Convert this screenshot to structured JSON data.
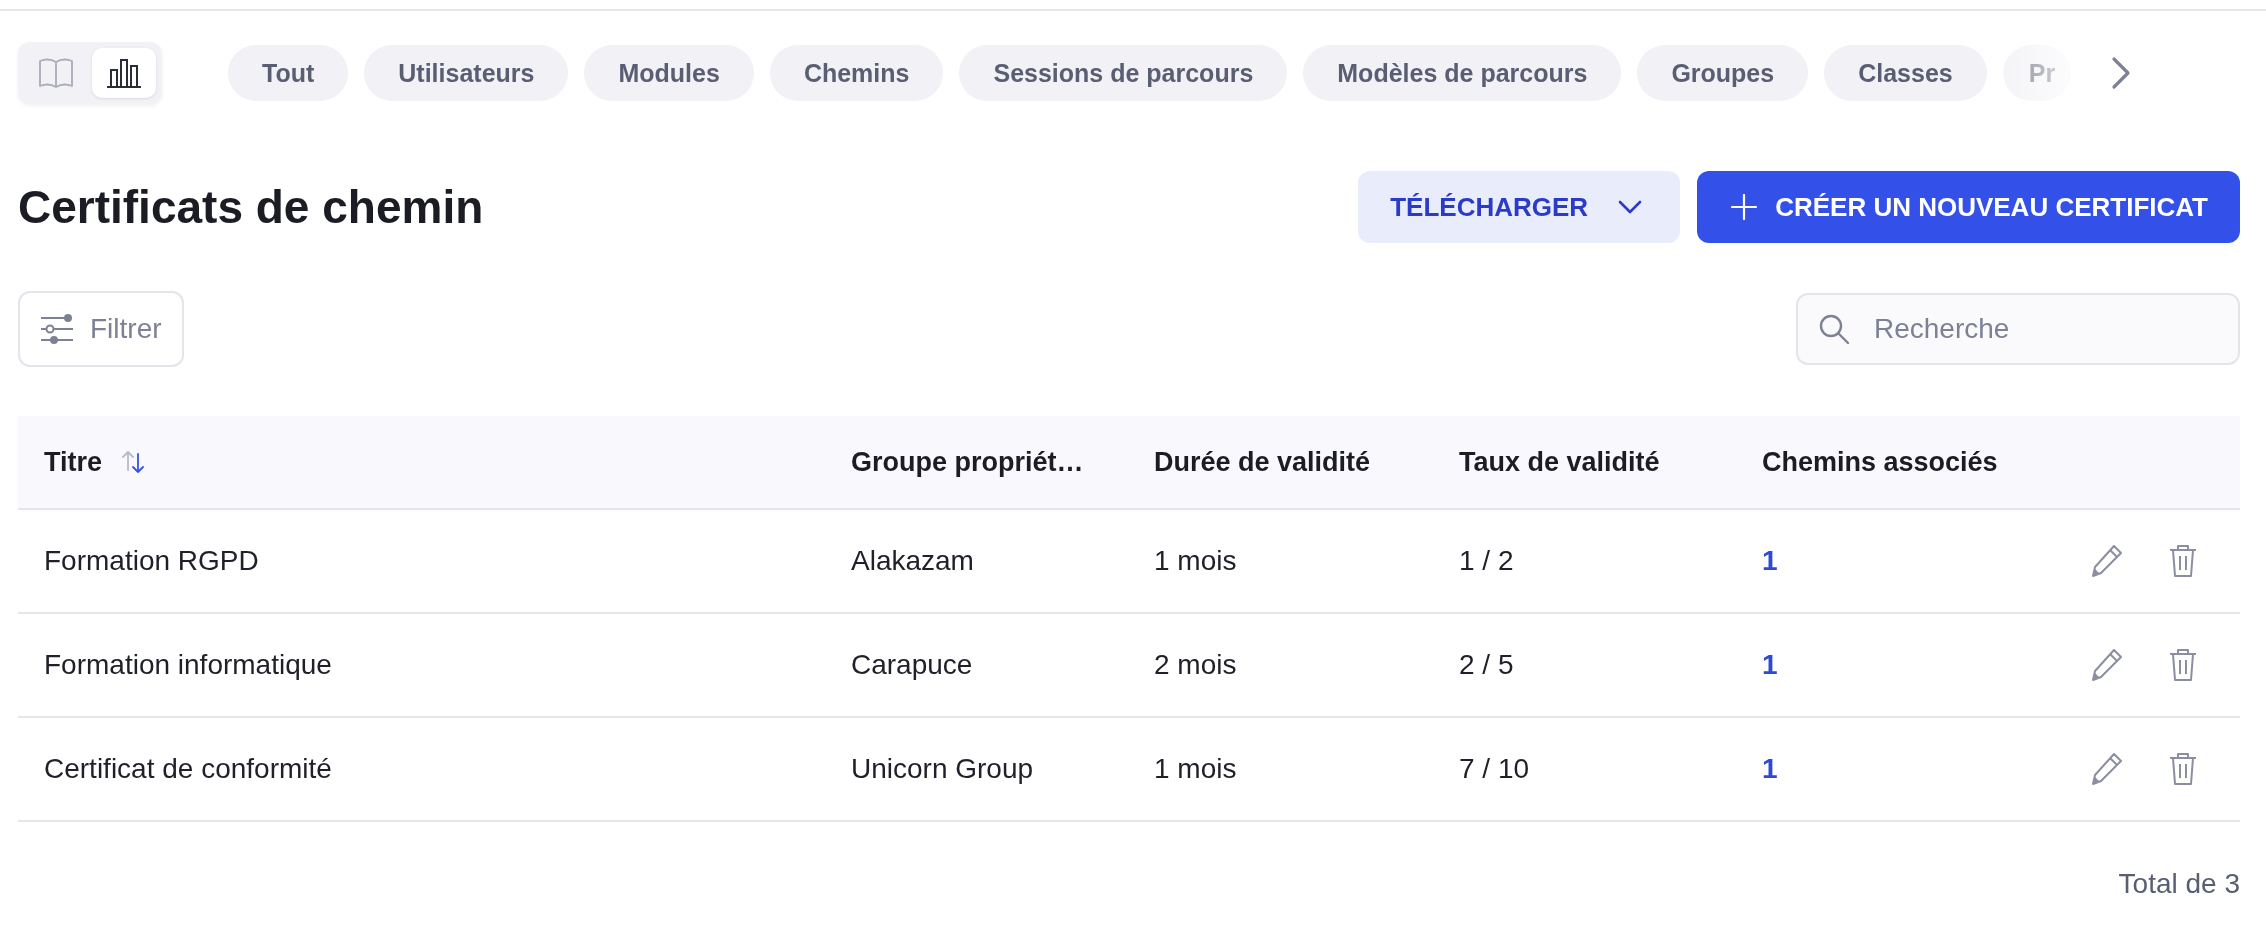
{
  "view_toggle": [
    {
      "kind": "book",
      "selected": false
    },
    {
      "kind": "chart",
      "selected": true
    }
  ],
  "filter_chips": [
    {
      "label": "Tout",
      "selected": false,
      "faded": false
    },
    {
      "label": "Utilisateurs",
      "selected": false,
      "faded": false
    },
    {
      "label": "Modules",
      "selected": false,
      "faded": false
    },
    {
      "label": "Chemins",
      "selected": false,
      "faded": false
    },
    {
      "label": "Sessions de parcours",
      "selected": false,
      "faded": false
    },
    {
      "label": "Modèles de parcours",
      "selected": false,
      "faded": false
    },
    {
      "label": "Groupes",
      "selected": false,
      "faded": false
    },
    {
      "label": "Classes",
      "selected": false,
      "faded": false
    },
    {
      "label": "Pr",
      "selected": false,
      "faded": true
    }
  ],
  "page_title": "Certificats de chemin",
  "download_button": "TÉLÉCHARGER",
  "create_button": "CRÉER UN NOUVEAU CERTIFICAT",
  "filter_button": "Filtrer",
  "search": {
    "placeholder": "Recherche"
  },
  "table": {
    "columns": [
      {
        "label": "Titre",
        "sorted": true
      },
      {
        "label": "Groupe propriét…",
        "sorted": false
      },
      {
        "label": "Durée de validité",
        "sorted": false
      },
      {
        "label": "Taux de validité",
        "sorted": false
      },
      {
        "label": "Chemins associés",
        "sorted": false
      }
    ],
    "rows": [
      [
        "Formation RGPD",
        "Alakazam",
        "1 mois",
        "1 / 2",
        "1"
      ],
      [
        "Formation informatique",
        "Carapuce",
        "2 mois",
        "2 / 5",
        "1"
      ],
      [
        "Certificat de conformité",
        "Unicorn Group",
        "1 mois",
        "7 / 10",
        "1"
      ]
    ]
  },
  "total": "Total de 3"
}
